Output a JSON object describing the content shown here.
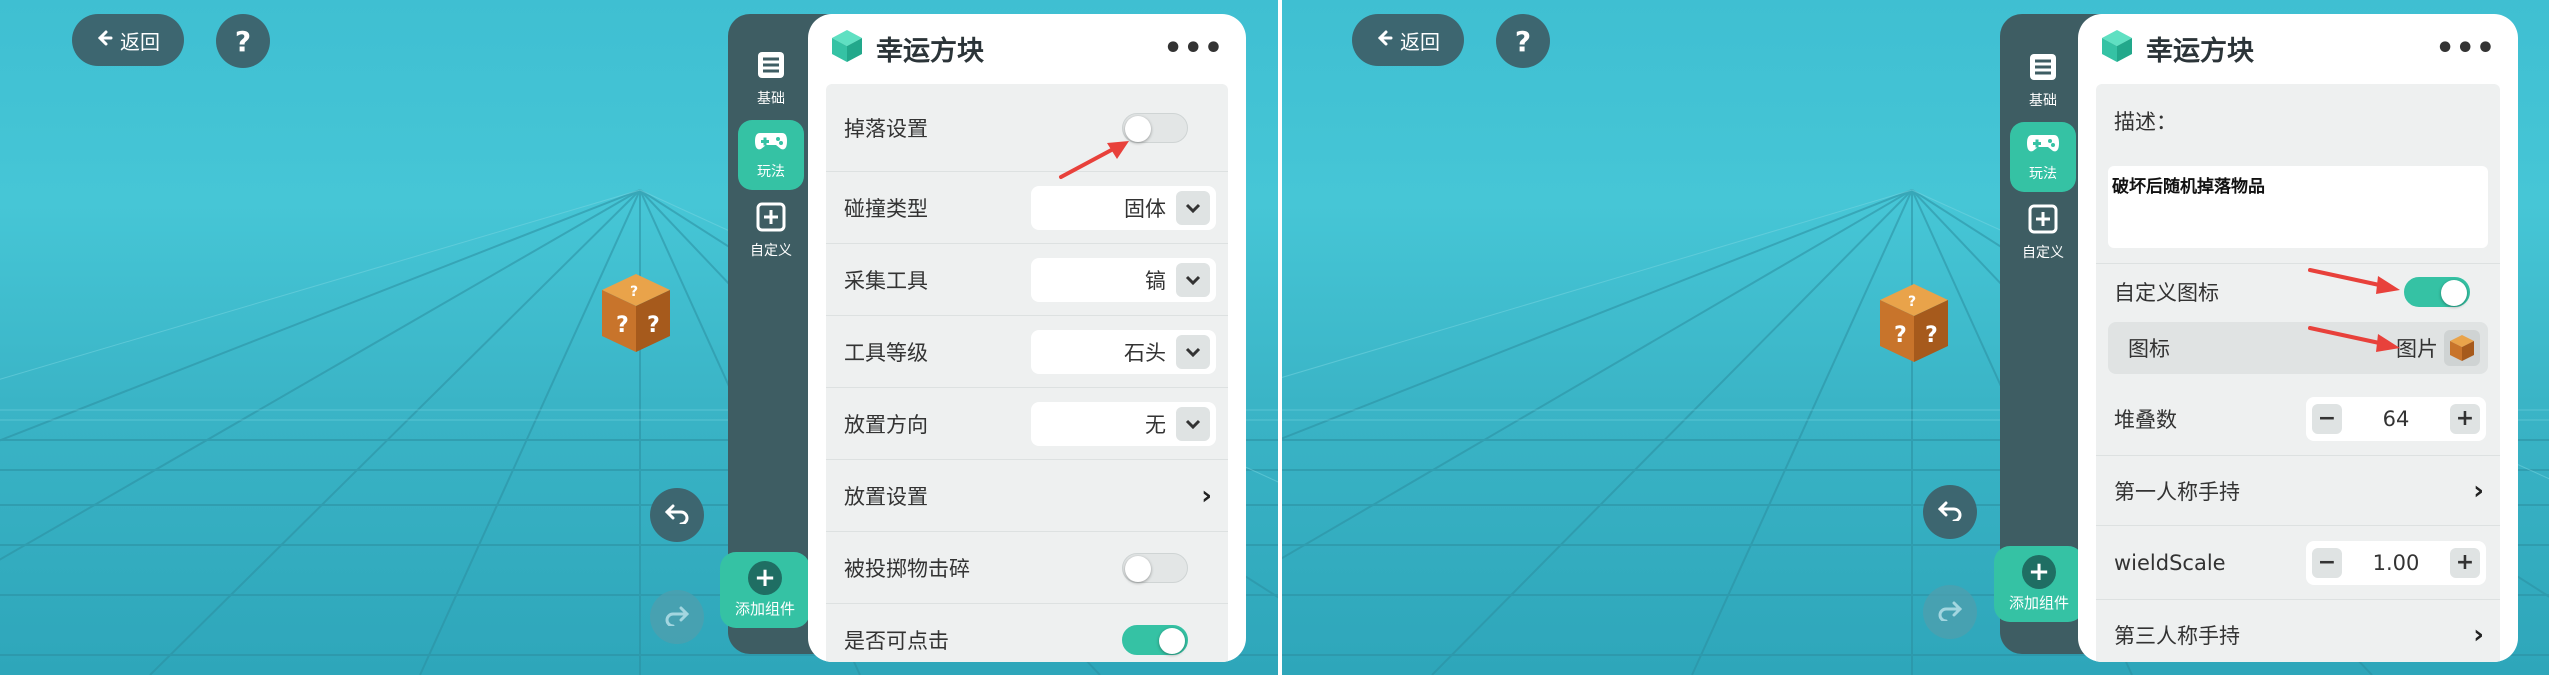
{
  "common": {
    "back_label": "返回",
    "help_label": "?",
    "panel_title": "幸运方块",
    "more_label": "•••",
    "tabs": [
      {
        "label": "基础",
        "icon": "list-icon"
      },
      {
        "label": "玩法",
        "icon": "gamepad-icon"
      },
      {
        "label": "自定义",
        "icon": "plus-square-icon"
      }
    ],
    "add_component_label": "添加组件",
    "add_component_plus": "+",
    "colors": {
      "accent": "#35c2a4",
      "rail": "#3e5d63",
      "scene": "#46c6d6",
      "arrow": "#e8413b"
    }
  },
  "left": {
    "rows": [
      {
        "label": "掉落设置",
        "type": "toggle",
        "on": false
      },
      {
        "label": "碰撞类型",
        "type": "select",
        "value": "固体"
      },
      {
        "label": "采集工具",
        "type": "select",
        "value": "镐"
      },
      {
        "label": "工具等级",
        "type": "select",
        "value": "石头"
      },
      {
        "label": "放置方向",
        "type": "select",
        "value": "无"
      },
      {
        "label": "放置设置",
        "type": "link"
      },
      {
        "label": "被投掷物击碎",
        "type": "toggle",
        "on": false
      },
      {
        "label": "是否可点击",
        "type": "toggle",
        "on": true
      }
    ]
  },
  "right": {
    "description_label": "描述：",
    "description_value": "破坏后随机掉落物品",
    "custom_icon_label": "自定义图标",
    "custom_icon_on": true,
    "icon_label": "图标",
    "icon_value": "图片",
    "stack_label": "堆叠数",
    "stack_value": "64",
    "first_person_label": "第一人称手持",
    "wield_scale_label": "wieldScale",
    "wield_scale_value": "1.00",
    "third_person_label": "第三人称手持",
    "minus": "−",
    "plus": "+"
  }
}
